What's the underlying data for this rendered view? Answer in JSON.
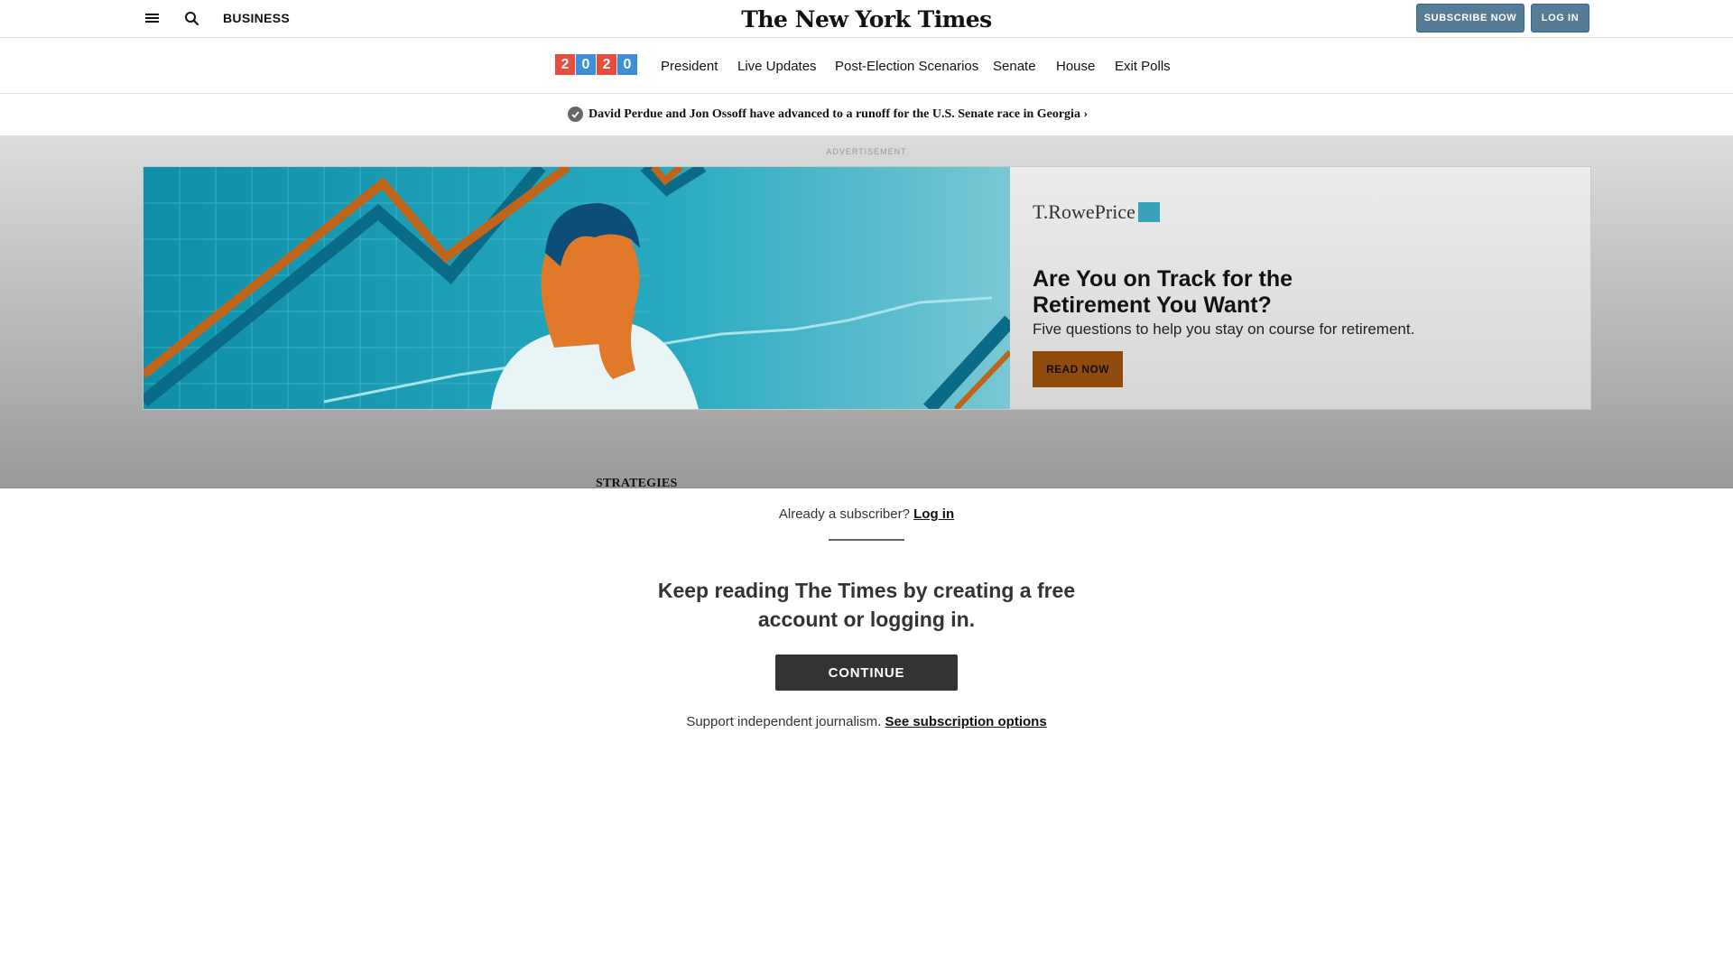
{
  "masthead": {
    "section": "BUSINESS",
    "logo": "The New York Times",
    "subscribe_label": "SUBSCRIBE NOW",
    "login_label": "LOG IN"
  },
  "election_nav": {
    "badge_digits": [
      "2",
      "0",
      "2",
      "0"
    ],
    "badge_colors": [
      "#e84c3d",
      "#3f8fd8",
      "#e84c3d",
      "#3f8fd8"
    ],
    "items": [
      "President",
      "Live Updates",
      "Post-Election Scenarios",
      "Senate",
      "House",
      "Exit Polls"
    ]
  },
  "alert": {
    "text": "David Perdue and Jon Ossoff have advanced to a runoff for the U.S. Senate race in Georgia ›"
  },
  "ad": {
    "label": "ADVERTISEMENT",
    "brand": "T.RowePrice",
    "headline": "Are You on Track for the Retirement You Want?",
    "subtext": "Five questions to help you stay on course for retirement.",
    "cta": "READ NOW",
    "colors": {
      "accent": "#c0641a",
      "teal": "#1fa3b8",
      "cta_bg": "#8f4a0c"
    }
  },
  "article": {
    "kicker": "STRATEGIES"
  },
  "gateway": {
    "already_text": "Already a subscriber?",
    "login_link": "Log in",
    "headline_line1": "Keep reading The Times by creating a free",
    "headline_line2": "account or logging in.",
    "continue_label": "CONTINUE",
    "support_text": "Support independent journalism.",
    "subscription_link": "See subscription options"
  },
  "icons": {
    "menu": "hamburger-icon",
    "search": "search-icon",
    "check": "check-circle-icon"
  }
}
